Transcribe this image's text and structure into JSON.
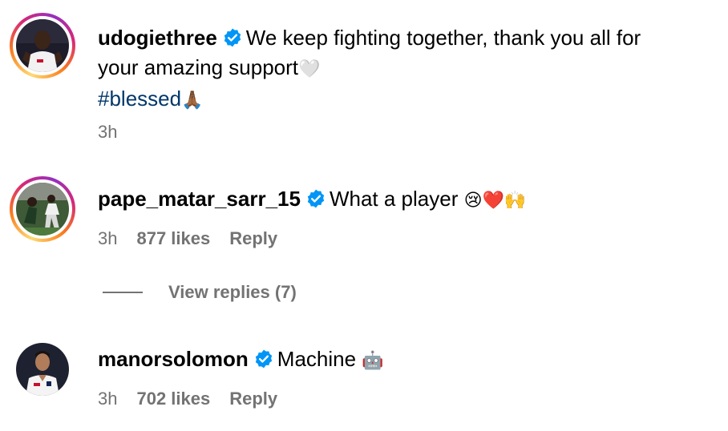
{
  "comments": [
    {
      "username": "udogiethree",
      "verified": true,
      "text_line1": "We keep fighting together, thank you all for",
      "text_line2": "your amazing support",
      "heart": "🤍",
      "hashtag": "#blessed",
      "hashtag_emoji": "🙏🏾",
      "time": "3h",
      "avatar_icon": "player-photo"
    },
    {
      "username": "pape_matar_sarr_15",
      "verified": true,
      "text": "What a player",
      "emojis": "😢❤️🙌",
      "time": "3h",
      "likes": "877 likes",
      "reply": "Reply",
      "avatar_icon": "player-photo"
    },
    {
      "username": "manorsolomon",
      "verified": true,
      "text": "Machine",
      "emojis": "🤖",
      "time": "3h",
      "likes": "702 likes",
      "reply": "Reply",
      "avatar_icon": "player-photo"
    }
  ],
  "view_replies": "View replies (7)",
  "colors": {
    "verified_blue": "#0095f6",
    "meta_gray": "#737373",
    "hashtag_blue": "#00376b"
  }
}
